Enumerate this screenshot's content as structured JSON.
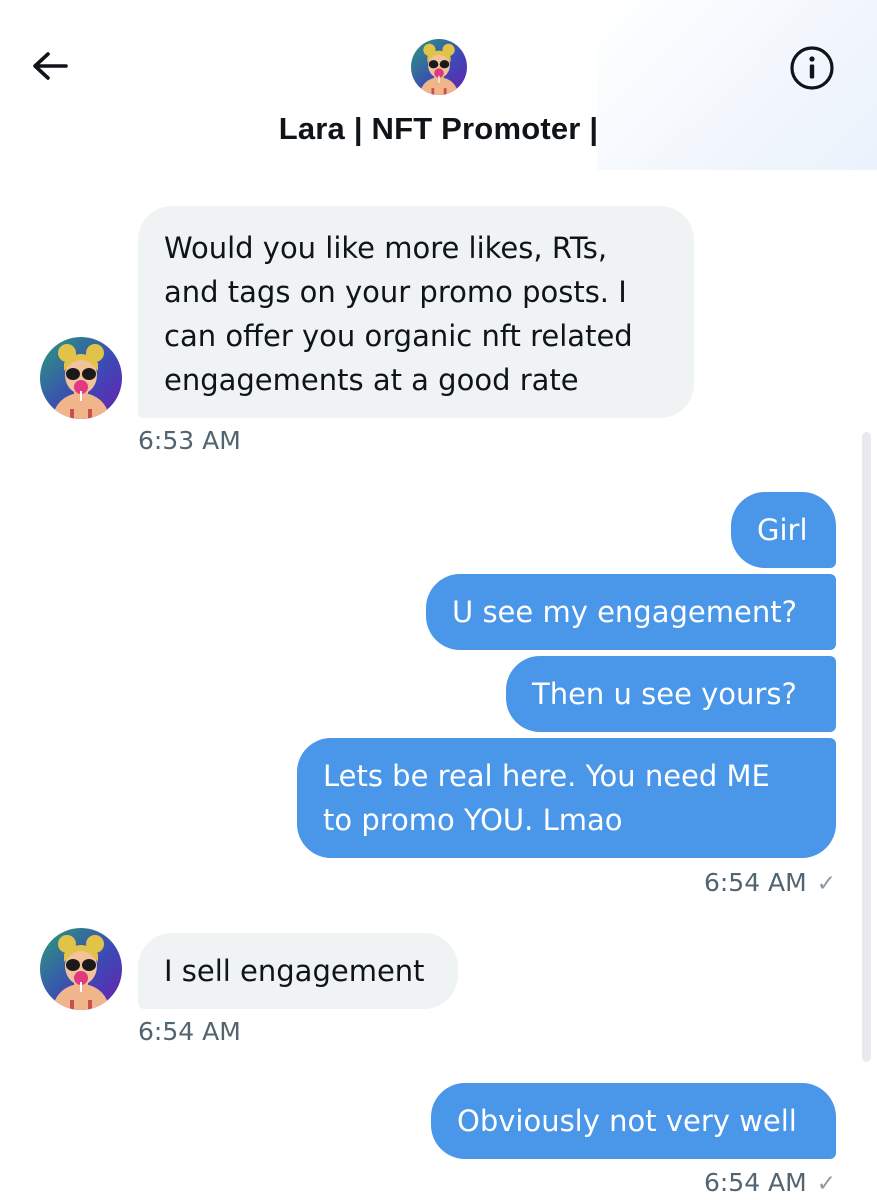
{
  "header": {
    "name": "Lara | NFT Promoter |",
    "back_icon": "arrow-left-icon",
    "info_icon": "info-circle-icon",
    "avatar": "contact-avatar"
  },
  "colors": {
    "outgoing_bubble": "#4a96e9",
    "incoming_bubble": "#eff3f4",
    "timestamp": "#536471"
  },
  "messages": [
    {
      "from": "them",
      "lines": [
        "Would you like more likes, RTs,",
        "and tags on your promo posts. I",
        "can offer you organic nft related",
        "engagements at a good rate"
      ],
      "time": "6:53 AM"
    },
    {
      "from": "me",
      "lines": [
        "Girl"
      ]
    },
    {
      "from": "me",
      "lines": [
        "U see my engagement?"
      ]
    },
    {
      "from": "me",
      "lines": [
        "Then u see yours?"
      ]
    },
    {
      "from": "me",
      "lines": [
        "Lets be real here. You need ME",
        "to promo YOU. Lmao"
      ],
      "time": "6:54 AM",
      "status": "✓"
    },
    {
      "from": "them",
      "lines": [
        "I sell engagement"
      ],
      "time": "6:54 AM"
    },
    {
      "from": "me",
      "lines": [
        "Obviously not very well"
      ],
      "time": "6:54 AM",
      "status": "✓"
    }
  ]
}
